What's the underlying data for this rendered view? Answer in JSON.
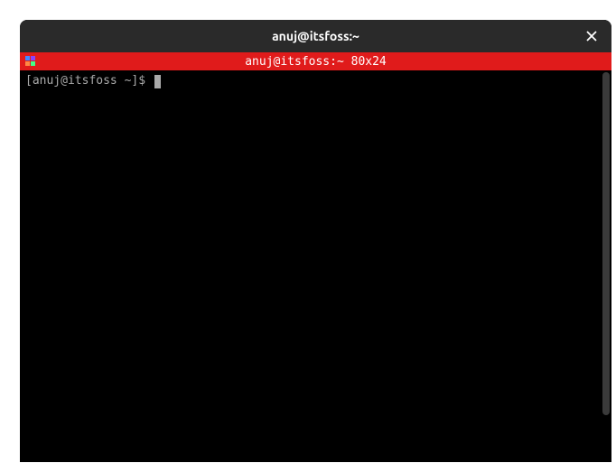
{
  "window": {
    "title": "anuj@itsfoss:~"
  },
  "tab": {
    "title": "anuj@itsfoss:~ 80x24"
  },
  "terminal": {
    "prompt": "[anuj@itsfoss ~]$ "
  }
}
